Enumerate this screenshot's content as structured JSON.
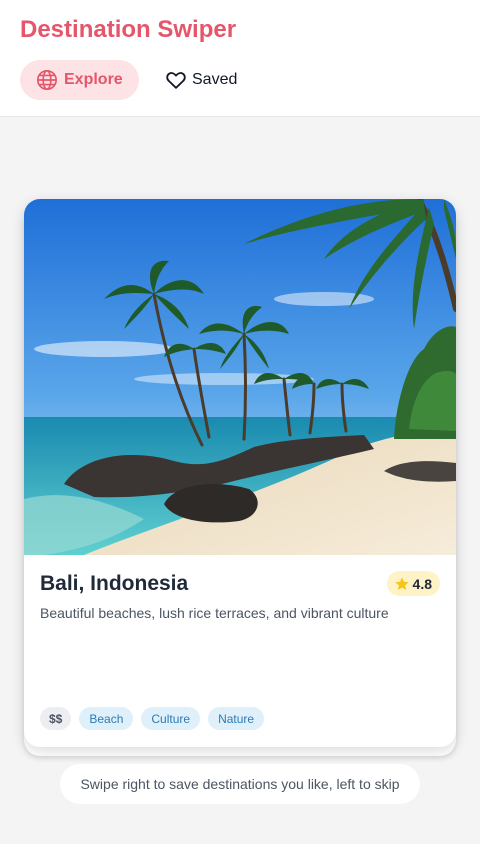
{
  "app": {
    "title": "Destination Swiper"
  },
  "nav": {
    "explore_label": "Explore",
    "saved_label": "Saved",
    "explore_icon": "globe-icon",
    "saved_icon": "heart-icon"
  },
  "card": {
    "name": "Bali, Indonesia",
    "rating": "4.8",
    "description": "Beautiful beaches, lush rice terraces, and vibrant culture",
    "price": "$$",
    "tags": [
      "Beach",
      "Culture",
      "Nature"
    ],
    "image_subject": "tropical beach with palm trees and rocks"
  },
  "hint": "Swipe right to save destinations you like, left to skip",
  "colors": {
    "accent": "#e5566a",
    "accent_bg": "#fde2e6",
    "rating_bg": "#fef3c7",
    "star": "#f5c518",
    "tag_bg": "#e0f0fb",
    "tag_text": "#2b7bb5",
    "page_bg": "#f4f4f5"
  }
}
